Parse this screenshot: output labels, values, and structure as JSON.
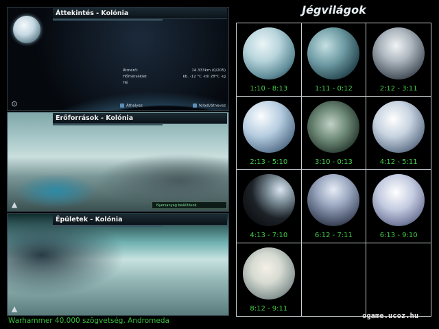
{
  "panels": {
    "overview": {
      "title": "Áttekintés - Kolónia",
      "info_rows": [
        {
          "label": "Átmérő:",
          "value": "14.333km (0/205)"
        },
        {
          "label": "Hőmérséklet",
          "value": "kb. -12 °C -tól 28°C -ig"
        },
        {
          "label": "Hé",
          "value": ""
        }
      ],
      "link_move": "Áthelyez",
      "link_rename": "feladl/átnevez"
    },
    "resources": {
      "title": "Erőforrások - Kolónia",
      "badge": "Nyersanyag beállítások"
    },
    "buildings": {
      "title": "Épületek - Kolónia"
    }
  },
  "footer_left": "Warhammer 40.000 szögvetség, Andromeda",
  "gallery": {
    "title": "Jégvilágok",
    "planets": [
      {
        "caption": "1:10 - 8:13"
      },
      {
        "caption": "1:11 - 0:12"
      },
      {
        "caption": "2:12 - 3:11"
      },
      {
        "caption": "2:13 - 5:10"
      },
      {
        "caption": "3:10 - 0:13"
      },
      {
        "caption": "4:12 - 5:11"
      },
      {
        "caption": "4:13 - 7:10"
      },
      {
        "caption": "6:12 - 7:11"
      },
      {
        "caption": "6:13 - 9:10"
      },
      {
        "caption": "8:12 - 9:11"
      }
    ]
  },
  "footer_right": "ogame.ucoz.hu",
  "colors": {
    "caption_green": "#45d14a",
    "footer_green": "#39c13d",
    "grid_border": "#c9cfd2"
  }
}
